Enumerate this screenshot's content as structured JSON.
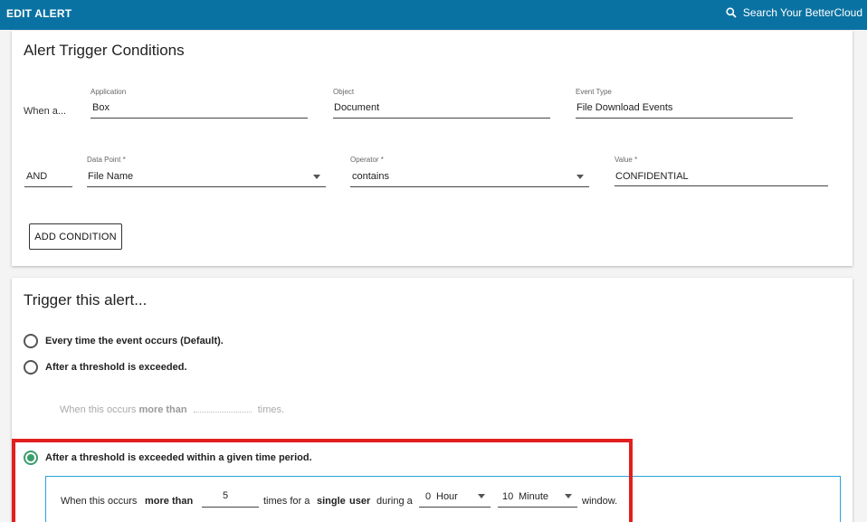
{
  "header": {
    "title": "EDIT ALERT",
    "search_label": "Search Your BetterCloud",
    "accent": "#0a72a2"
  },
  "conditions": {
    "title": "Alert Trigger Conditions",
    "when_label": "When a...",
    "application": {
      "label": "Application",
      "value": "Box"
    },
    "object": {
      "label": "Object",
      "value": "Document"
    },
    "event_type": {
      "label": "Event Type",
      "value": "File Download Events"
    },
    "and_label": "AND",
    "data_point": {
      "label": "Data Point *",
      "value": "File Name"
    },
    "operator": {
      "label": "Operator *",
      "value": "contains"
    },
    "value": {
      "label": "Value *",
      "value": "CONFIDENTIAL"
    },
    "add_button": "ADD CONDITION"
  },
  "trigger": {
    "title": "Trigger this alert...",
    "options": [
      {
        "label": "Every time the event occurs (Default).",
        "selected": false
      },
      {
        "label": "After a threshold is exceeded.",
        "selected": false
      },
      {
        "label": "After a threshold is exceeded within a given time period.",
        "selected": true
      }
    ],
    "threshold_row": {
      "prefix": "When this occurs",
      "bold": "more than",
      "suffix": "times."
    },
    "time_period_row": {
      "prefix": "When this occurs",
      "bold1": "more than",
      "count": "5",
      "mid": "times for a",
      "bold2": "single",
      "bold3": "user",
      "during": "during a",
      "hour_value": "0",
      "hour_unit": "Hour",
      "minute_value": "10",
      "minute_unit": "Minute",
      "suffix": "window."
    },
    "selected_color": "#3a9e6c",
    "highlight_color": "#e21f1f"
  }
}
